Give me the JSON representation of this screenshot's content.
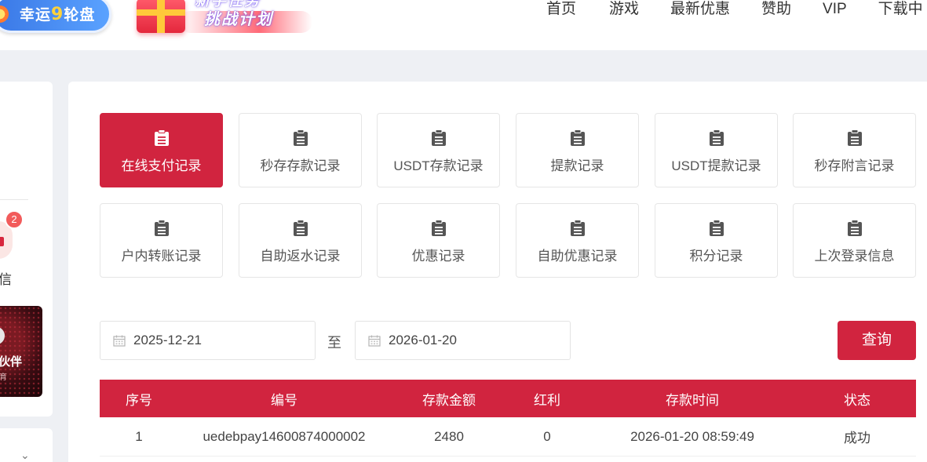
{
  "header": {
    "lucky_banner": {
      "text_a": "幸运",
      "text_num": "9",
      "text_b": "轮盘"
    },
    "task_banner": {
      "line1": "新手任务",
      "line2": "挑战计划"
    },
    "nav": [
      "首页",
      "游戏",
      "最新优惠",
      "赞助",
      "VIP",
      "下载中"
    ]
  },
  "sidebar": {
    "badge_count": "2",
    "message_label": "信",
    "partner_title": "伙伴",
    "partner_sub": "育",
    "chevron_icon": "chevron-down-icon"
  },
  "tabs": [
    {
      "label": "在线支付记录",
      "active": true
    },
    {
      "label": "秒存存款记录"
    },
    {
      "label": "USDT存款记录"
    },
    {
      "label": "提款记录"
    },
    {
      "label": "USDT提款记录"
    },
    {
      "label": "秒存附言记录"
    },
    {
      "label": "户内转账记录"
    },
    {
      "label": "自助返水记录"
    },
    {
      "label": "优惠记录"
    },
    {
      "label": "自助优惠记录"
    },
    {
      "label": "积分记录"
    },
    {
      "label": "上次登录信息"
    }
  ],
  "filter": {
    "start_date": "2025-12-21",
    "to_label": "至",
    "end_date": "2026-01-20",
    "query_label": "查询"
  },
  "table": {
    "headers": [
      "序号",
      "编号",
      "存款金额",
      "红利",
      "存款时间",
      "状态"
    ],
    "rows": [
      [
        "1",
        "uedebpay14600874000002",
        "2480",
        "0",
        "2026-01-20 08:59:49",
        "成功"
      ]
    ]
  },
  "colors": {
    "accent": "#d1243f",
    "page_bg": "#eef0f4"
  }
}
